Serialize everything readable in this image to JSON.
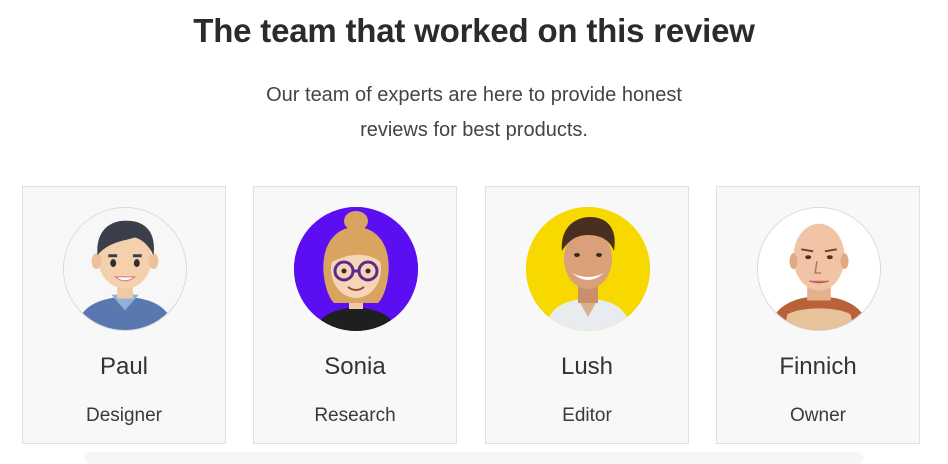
{
  "header": {
    "title": "The team that worked on this review",
    "subtitle_line1": "Our team of experts are here to provide honest",
    "subtitle_line2": "reviews for best products."
  },
  "team": [
    {
      "name": "Paul",
      "role": "Designer"
    },
    {
      "name": "Sonia",
      "role": "Research"
    },
    {
      "name": "Lush",
      "role": "Editor"
    },
    {
      "name": "Finnich",
      "role": "Owner"
    }
  ],
  "colors": {
    "card_bg": "#f8f8f8",
    "card_border": "#e0e0e0",
    "sonia_avatar_bg": "#5b0ef2",
    "lush_avatar_bg": "#f7d900"
  }
}
